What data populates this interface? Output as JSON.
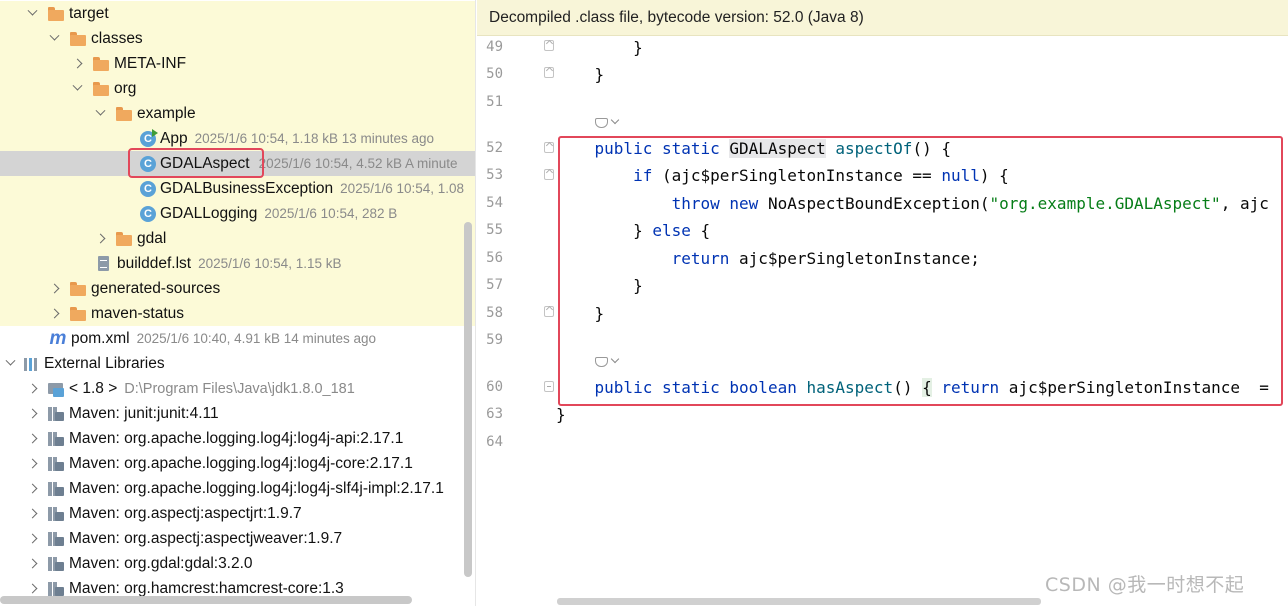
{
  "tree": {
    "target": {
      "label": "target"
    },
    "classes": {
      "label": "classes"
    },
    "meta_inf": {
      "label": "META-INF"
    },
    "org": {
      "label": "org"
    },
    "example": {
      "label": "example"
    },
    "app": {
      "label": "App",
      "meta": "2025/1/6 10:54, 1.18 kB 13 minutes ago"
    },
    "gdal_aspect": {
      "label": "GDALAspect",
      "meta": "2025/1/6 10:54, 4.52 kB A minute"
    },
    "gdal_business_exception": {
      "label": "GDALBusinessException",
      "meta": "2025/1/6 10:54, 1.08"
    },
    "gdal_logging": {
      "label": "GDALLogging",
      "meta": "2025/1/6 10:54, 282 B"
    },
    "gdal": {
      "label": "gdal"
    },
    "builddef": {
      "label": "builddef.lst",
      "meta": "2025/1/6 10:54, 1.15 kB"
    },
    "generated_sources": {
      "label": "generated-sources"
    },
    "maven_status": {
      "label": "maven-status"
    },
    "pom": {
      "label": "pom.xml",
      "meta": "2025/1/6 10:40, 4.91 kB 14 minutes ago",
      "icon_glyph": "m"
    },
    "external_libraries": {
      "label": "External Libraries"
    },
    "jdk": {
      "label": "< 1.8 >",
      "meta": "D:\\Program Files\\Java\\jdk1.8.0_181"
    },
    "libraries": [
      "Maven: junit:junit:4.11",
      "Maven: org.apache.logging.log4j:log4j-api:2.17.1",
      "Maven: org.apache.logging.log4j:log4j-core:2.17.1",
      "Maven: org.apache.logging.log4j:log4j-slf4j-impl:2.17.1",
      "Maven: org.aspectj:aspectjrt:1.9.7",
      "Maven: org.aspectj:aspectjweaver:1.9.7",
      "Maven: org.gdal:gdal:3.2.0",
      "Maven: org.hamcrest:hamcrest-core:1.3"
    ]
  },
  "editor": {
    "banner": "Decompiled .class file, bytecode version: 52.0 (Java 8)",
    "line_numbers": [
      "49",
      "50",
      "51",
      "52",
      "53",
      "54",
      "55",
      "56",
      "57",
      "58",
      "59",
      "60",
      "63",
      "64"
    ],
    "code": {
      "l49": "}",
      "l50": "}",
      "l52_kw1": "public",
      "l52_kw2": "static",
      "l52_type": "GDALAspect",
      "l52_fn": "aspectOf",
      "l52_rest": "() {",
      "l53_kw": "if",
      "l53_mid": " (ajc$perSingletonInstance == ",
      "l53_null": "null",
      "l53_end": ") {",
      "l54_kw1": "throw",
      "l54_kw2": "new",
      "l54_mid": " NoAspectBoundException(",
      "l54_str": "\"org.example.GDALAspect\"",
      "l54_end": ", ajc",
      "l55_open": "} ",
      "l55_kw": "else",
      "l55_end": " {",
      "l56_kw": "return",
      "l56_rest": " ajc$perSingletonInstance;",
      "l57": "}",
      "l58": "}",
      "l60_kw1": "public",
      "l60_kw2": "static",
      "l60_kw3": "boolean",
      "l60_fn": "hasAspect",
      "l60_paren": "() ",
      "l60_brace": "{",
      "l60_kw4": "return",
      "l60_rest": " ajc$perSingletonInstance  =",
      "l63": "}"
    },
    "watermark": "CSDN @我一时想不起"
  },
  "colors": {
    "keyword": "#0033b3",
    "function": "#00627a",
    "string": "#067d17",
    "highlight_row": "#fcfad7",
    "selection_row": "#d4d4d4",
    "annotation_box": "#e2475a",
    "banner_bg": "#f8f5d8"
  },
  "icons": {
    "folder": "folder-icon",
    "class": "java-class-icon",
    "runnable_class": "java-runnable-class-icon",
    "file": "text-file-icon",
    "maven": "maven-icon",
    "libraries": "libraries-icon",
    "jar": "jar-library-icon",
    "jdk": "jdk-icon",
    "inlay_hint": "inlay-hint-icon"
  }
}
